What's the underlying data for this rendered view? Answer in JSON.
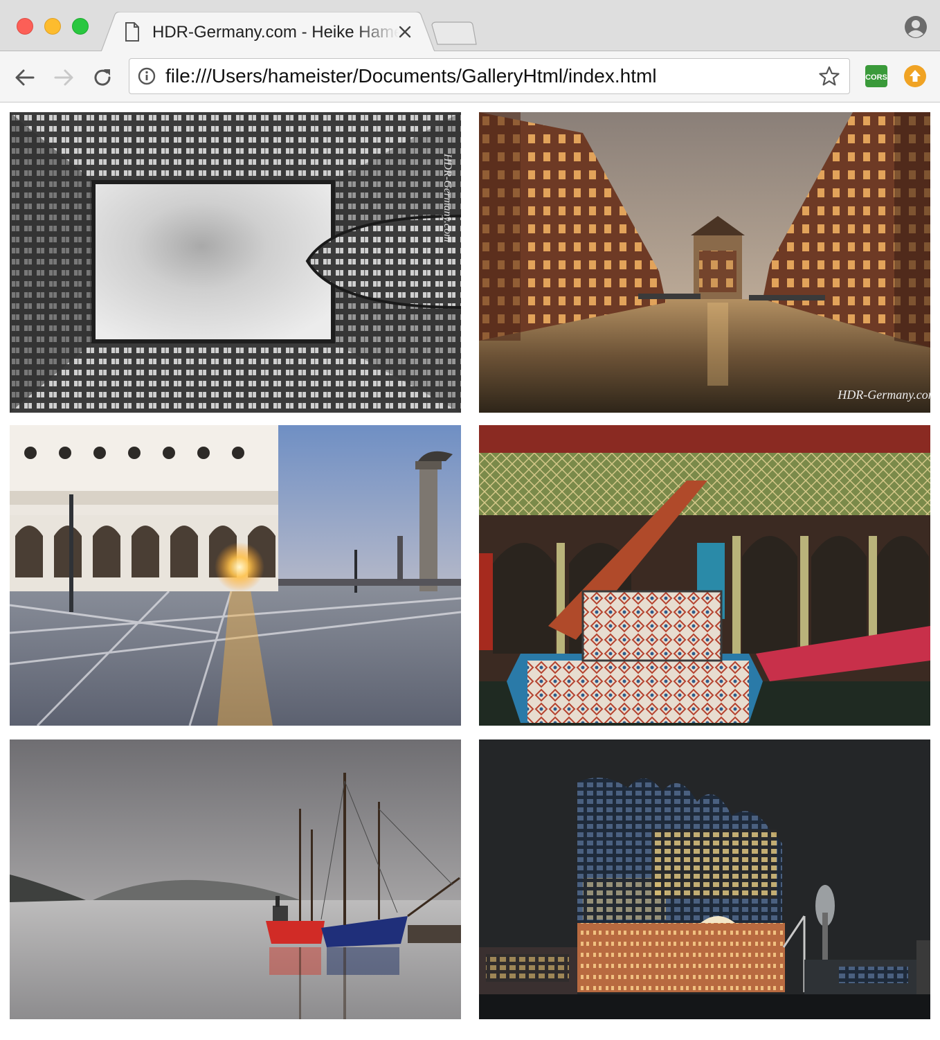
{
  "window": {
    "tab": {
      "title": "HDR-Germany.com - Heike Hameister"
    },
    "address_bar": {
      "url": "file:///Users/hameister/Documents/GalleryHtml/index.html"
    },
    "extensions": [
      {
        "name": "cors-extension",
        "label": "CORS",
        "color": "#3a9a3a"
      },
      {
        "name": "upload-extension",
        "label": "",
        "color": "#f0a324"
      }
    ]
  },
  "gallery": {
    "photos": [
      {
        "name": "photo-chilehaus-courtyard",
        "watermark": "HDR-Germany.com"
      },
      {
        "name": "photo-speicherstadt-canal",
        "watermark": "HDR-Germany.com"
      },
      {
        "name": "photo-venice-piazzetta-sunrise",
        "watermark": ""
      },
      {
        "name": "photo-ornate-arcade-fountain",
        "watermark": ""
      },
      {
        "name": "photo-sailing-ships-harbor",
        "watermark": ""
      },
      {
        "name": "photo-elbphilharmonie-night",
        "watermark": ""
      }
    ]
  },
  "colors": {
    "titlebar": "#dedede",
    "toolbar": "#f5f5f5",
    "close": "#fc5f57",
    "minimize": "#fdbc2e",
    "maximize": "#29c73f"
  }
}
